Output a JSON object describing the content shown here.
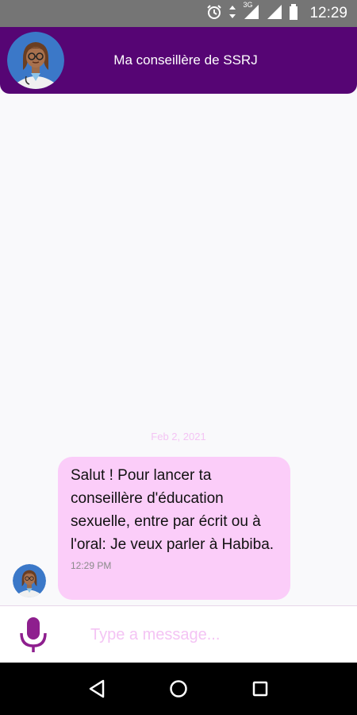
{
  "status_bar": {
    "time": "12:29",
    "network": "3G"
  },
  "header": {
    "title": "Ma conseillère de SSRJ",
    "accent": "#560574"
  },
  "chat": {
    "date": "Feb 2, 2021",
    "messages": [
      {
        "text": "Salut ! Pour lancer ta conseillère d'éducation sexuelle, entre par écrit ou à l'oral: Je veux parler à Habiba.",
        "time": "12:29 PM",
        "bubble_color": "#fbcdf9"
      }
    ]
  },
  "composer": {
    "placeholder": "Type a message..."
  },
  "icons": {
    "mic": "microphone-icon",
    "back": "back-triangle-icon",
    "home": "home-circle-icon",
    "recents": "recents-square-icon"
  }
}
